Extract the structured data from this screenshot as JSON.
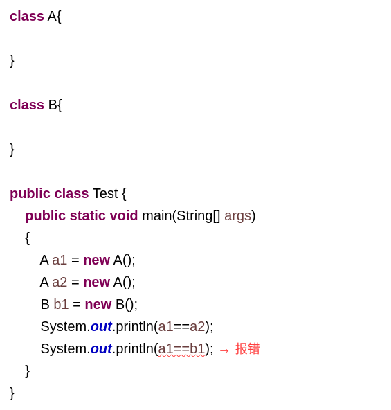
{
  "code": {
    "line1_kw": "class",
    "line1_name": " A{",
    "line2": "",
    "line3": "}",
    "line4": "",
    "line5_kw": "class",
    "line5_name": " B{",
    "line6": "",
    "line7": "}",
    "line8": "",
    "line9_kw1": "public",
    "line9_kw2": " class",
    "line9_name": " Test {",
    "line10_kw1": "public",
    "line10_kw2": " static",
    "line10_kw3": " void",
    "line10_name": " main(String[] ",
    "line10_param": "args",
    "line10_close": ")",
    "line11": "    {",
    "line12_a": "        A ",
    "line12_var": "a1",
    "line12_b": " = ",
    "line12_kw": "new",
    "line12_c": " A();",
    "line13_a": "        A ",
    "line13_var": "a2",
    "line13_b": " = ",
    "line13_kw": "new",
    "line13_c": " A();",
    "line14_a": "        B ",
    "line14_var": "b1",
    "line14_b": " = ",
    "line14_kw": "new",
    "line14_c": " B();",
    "line15_a": "        System.",
    "line15_field": "out",
    "line15_b": ".println(",
    "line15_v1": "a1",
    "line15_eq": "==",
    "line15_v2": "a2",
    "line15_c": ");",
    "line16_a": "        System.",
    "line16_field": "out",
    "line16_b": ".println(",
    "line16_expr": "a1==b1",
    "line16_c": ");",
    "line17": "    }",
    "line18": "}"
  },
  "annotation": {
    "arrow": " → ",
    "text": "报错"
  }
}
